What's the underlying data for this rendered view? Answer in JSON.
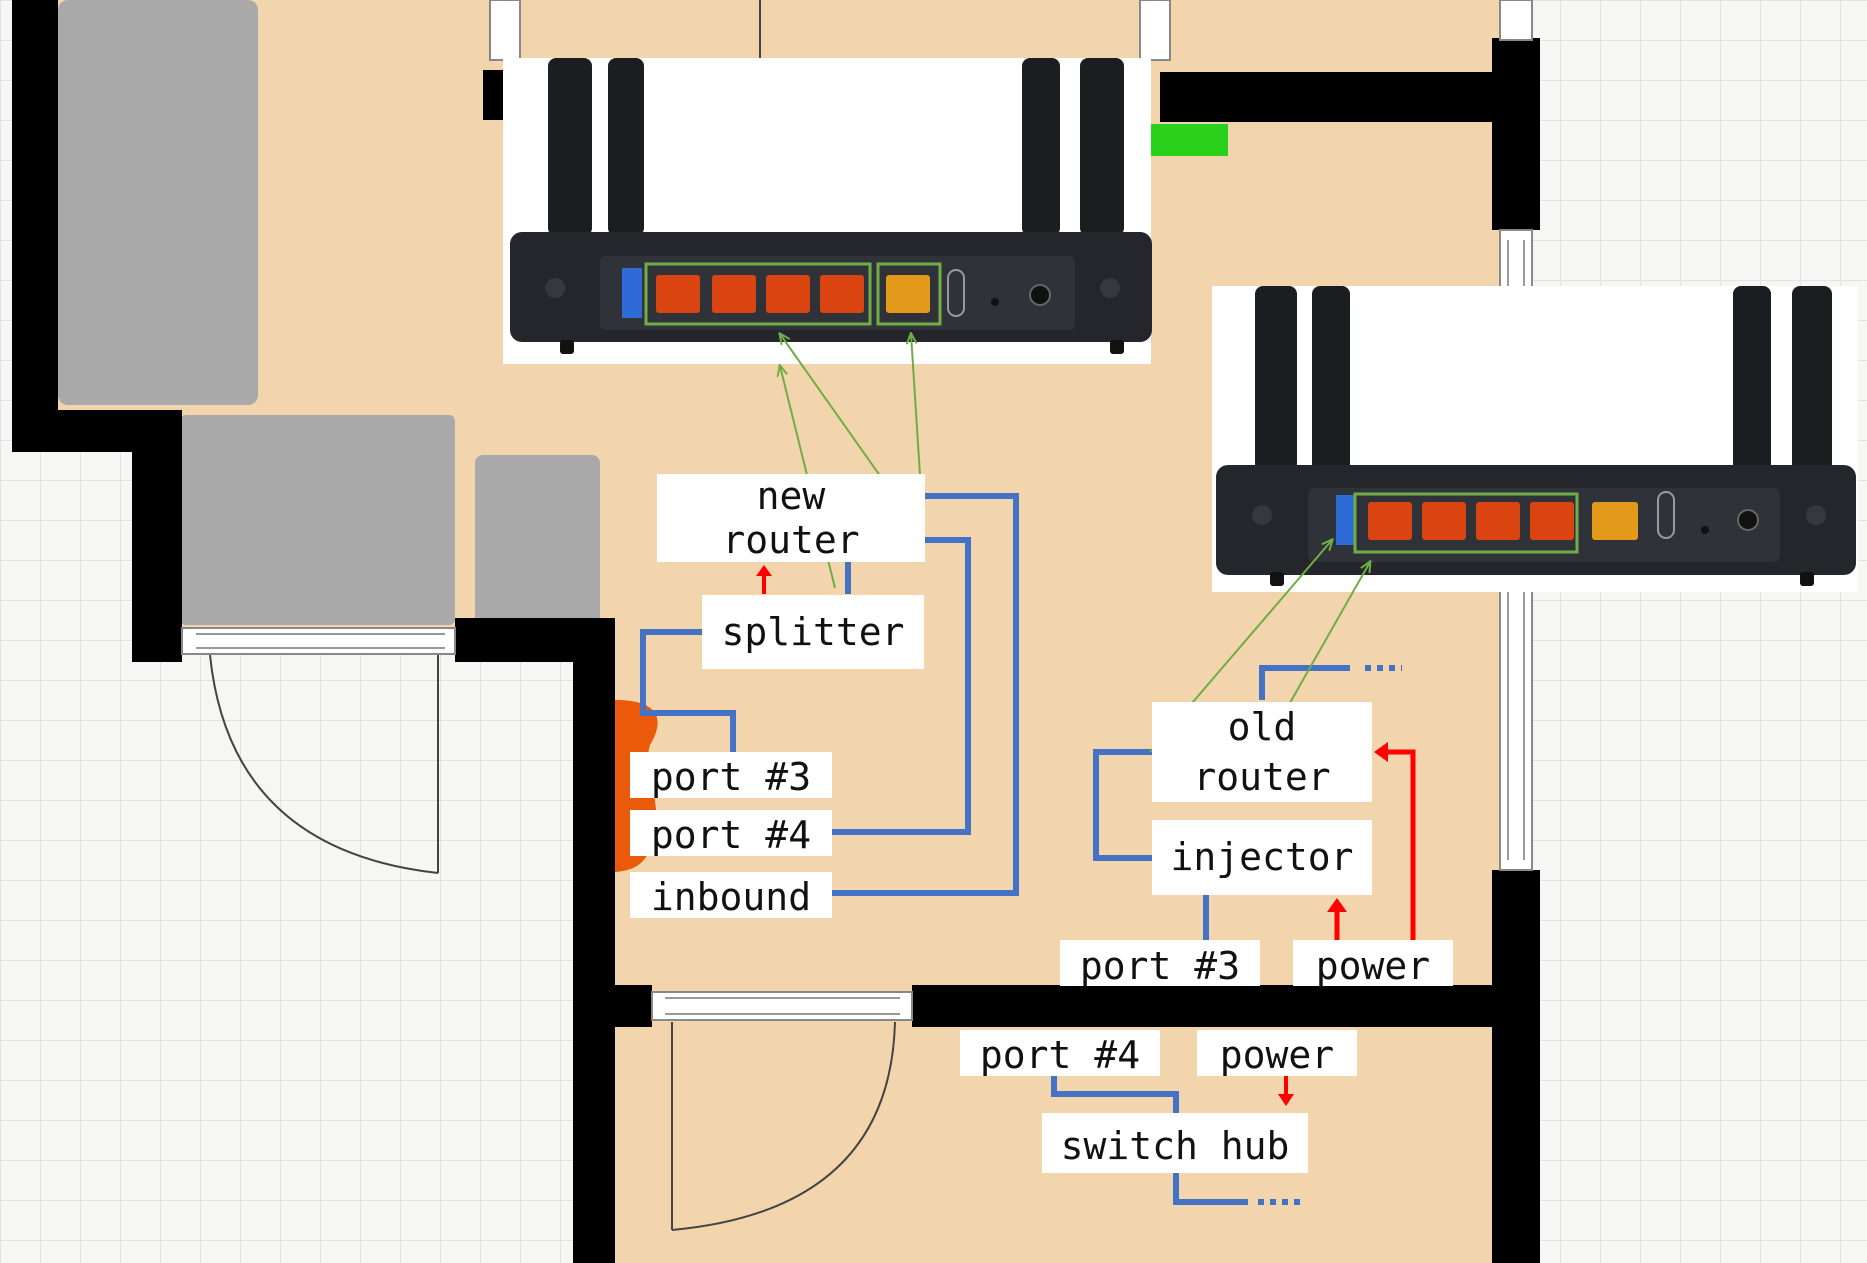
{
  "labels": {
    "new_router": [
      "new",
      "router"
    ],
    "splitter": "splitter",
    "port3_left": "port #3",
    "port4_left": "port #4",
    "inbound": "inbound",
    "old_router": [
      "old",
      "router"
    ],
    "injector": "injector",
    "port3_right": "port #3",
    "power_right": "power",
    "port4_bottom": "port #4",
    "power_bottom": "power",
    "switch_hub": "switch hub"
  },
  "colors": {
    "floor": "#f2d5ac",
    "wall": "#000000",
    "furniture": "#a9a9a9",
    "cable": "#4472c4",
    "power_arrow": "#ff0000",
    "port_link": "#70ad47",
    "lan_port": "#d94410",
    "wan_port": "#e39a1a",
    "router_body": "#24262b",
    "grid_line": "#e2e2e2",
    "grid_bg": "#f6f6f4",
    "outlet": "#ea5a0a",
    "marker": "#2ad11a"
  }
}
